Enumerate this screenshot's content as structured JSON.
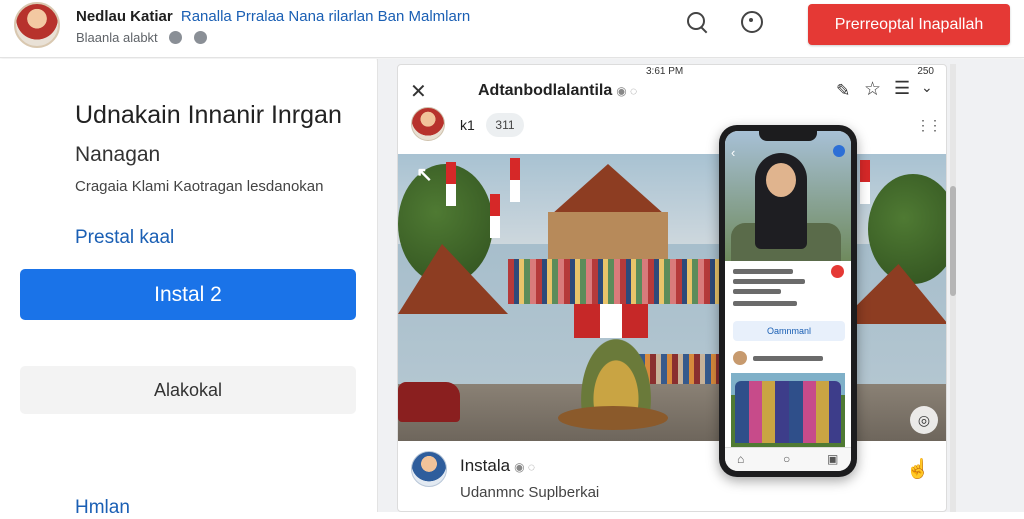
{
  "header": {
    "name": "Nedlau Katiar",
    "subtitle": "Ranalla Prralaa Nana rilarlan Ban Malmlarn",
    "meta": "Blaanla alabkt",
    "action_button": "Prerreoptal Inapallah"
  },
  "sidebar": {
    "heading": "Udnakain Innanir Inrgan",
    "subheading": "Nanagan",
    "description": "Cragaia Klami Kaotragan lesdanokan",
    "link_label": "Prestal kaal",
    "install_button": "Instal 2",
    "secondary_button": "Alakokal",
    "footer_link": "Hmlan"
  },
  "post": {
    "status_time": "3:61 PM",
    "status_signal": "250",
    "title": "Adtanbodlalantila",
    "author_name": "k1",
    "author_chip": "311",
    "comment_name": "Instala",
    "comment_text": "Udanmnc Suplberkai"
  },
  "phone": {
    "button_label": "Oamnmanl"
  },
  "colors": {
    "accent_red": "#e53935",
    "accent_blue": "#1a73e8",
    "link_blue": "#1a5fb4"
  }
}
